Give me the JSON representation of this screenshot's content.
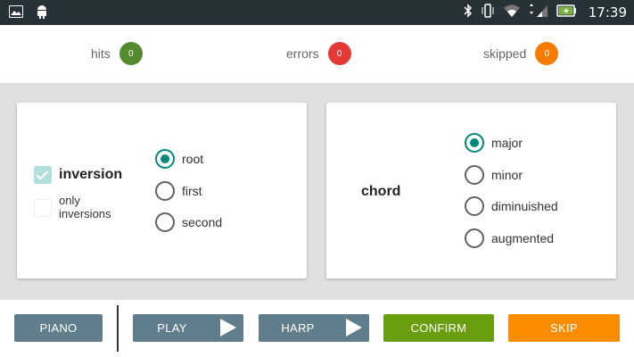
{
  "status_bar": {
    "time": "17:39",
    "icons": [
      "gallery-icon",
      "android-icon",
      "bluetooth-icon",
      "vibrate-icon",
      "wifi-icon",
      "signal-icon",
      "battery-charging-icon"
    ]
  },
  "stats": {
    "hits": {
      "label": "hits",
      "value": "0",
      "color": "#558b2f"
    },
    "errors": {
      "label": "errors",
      "value": "0",
      "color": "#e53935"
    },
    "skipped": {
      "label": "skipped",
      "value": "0",
      "color": "#f57c00"
    }
  },
  "inversion_card": {
    "title": "inversion",
    "title_checked": true,
    "only_inversions_label": "only inversions",
    "only_inversions_checked": false,
    "options": [
      {
        "label": "root",
        "selected": true
      },
      {
        "label": "first",
        "selected": false
      },
      {
        "label": "second",
        "selected": false
      }
    ]
  },
  "chord_card": {
    "title": "chord",
    "options": [
      {
        "label": "major",
        "selected": true
      },
      {
        "label": "minor",
        "selected": false
      },
      {
        "label": "diminuished",
        "selected": false
      },
      {
        "label": "augmented",
        "selected": false
      }
    ]
  },
  "buttons": {
    "piano": "PIANO",
    "play": "PLAY",
    "harp": "HARP",
    "confirm": "CONFIRM",
    "skip": "SKIP"
  },
  "colors": {
    "accent": "#00897b",
    "confirm": "#6a9e0f",
    "skip": "#fb8c00",
    "grey_button": "#607d8b"
  }
}
